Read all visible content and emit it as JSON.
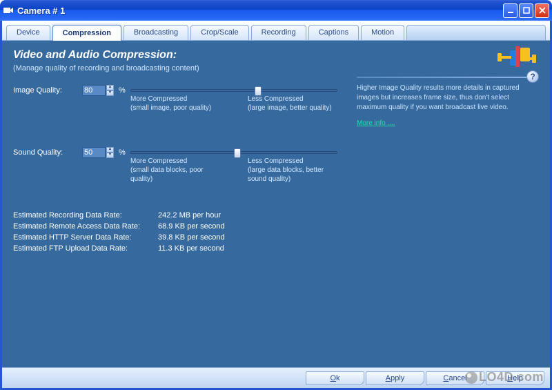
{
  "window": {
    "title": "Camera # 1"
  },
  "tabs": [
    {
      "label": "Device"
    },
    {
      "label": "Compression"
    },
    {
      "label": "Broadcasting"
    },
    {
      "label": "Crop/Scale"
    },
    {
      "label": "Recording"
    },
    {
      "label": "Captions"
    },
    {
      "label": "Motion"
    }
  ],
  "section": {
    "title": "Video and Audio Compression:",
    "subtitle": "(Manage quality of recording and broadcasting content)"
  },
  "image_quality": {
    "label": "Image Quality:",
    "value": "80",
    "unit": "%",
    "left_hint_title": "More Compressed",
    "left_hint_sub": "(small image, poor quality)",
    "right_hint_title": "Less Compressed",
    "right_hint_sub": "(large image, better quality)",
    "slider_pct": 60
  },
  "sound_quality": {
    "label": "Sound Quality:",
    "value": "50",
    "unit": "%",
    "left_hint_title": "More Compressed",
    "left_hint_sub": "(small data blocks, poor quality)",
    "right_hint_title": "Less Compressed",
    "right_hint_sub": "(large data blocks, better sound quality)",
    "slider_pct": 50
  },
  "help": {
    "text": "Higher Image Quality results more details in captured images but increases frame size, thus don't select maximum quality if you want broadcast live video.",
    "link": "More info ...."
  },
  "stats": {
    "rows": [
      {
        "label": "Estimated Recording Data Rate:",
        "value": "242.2 MB per hour"
      },
      {
        "label": "Estimated Remote Access Data Rate:",
        "value": "68.9 KB per second"
      },
      {
        "label": "Estimated HTTP Server Data Rate:",
        "value": "39.8 KB per second"
      },
      {
        "label": "Estimated FTP Upload Data Rate:",
        "value": "11.3 KB per second"
      }
    ]
  },
  "footer": {
    "ok": "Ok",
    "apply": "Apply",
    "cancel": "Cancel",
    "help": "Help"
  },
  "watermark": "LO4D.com"
}
